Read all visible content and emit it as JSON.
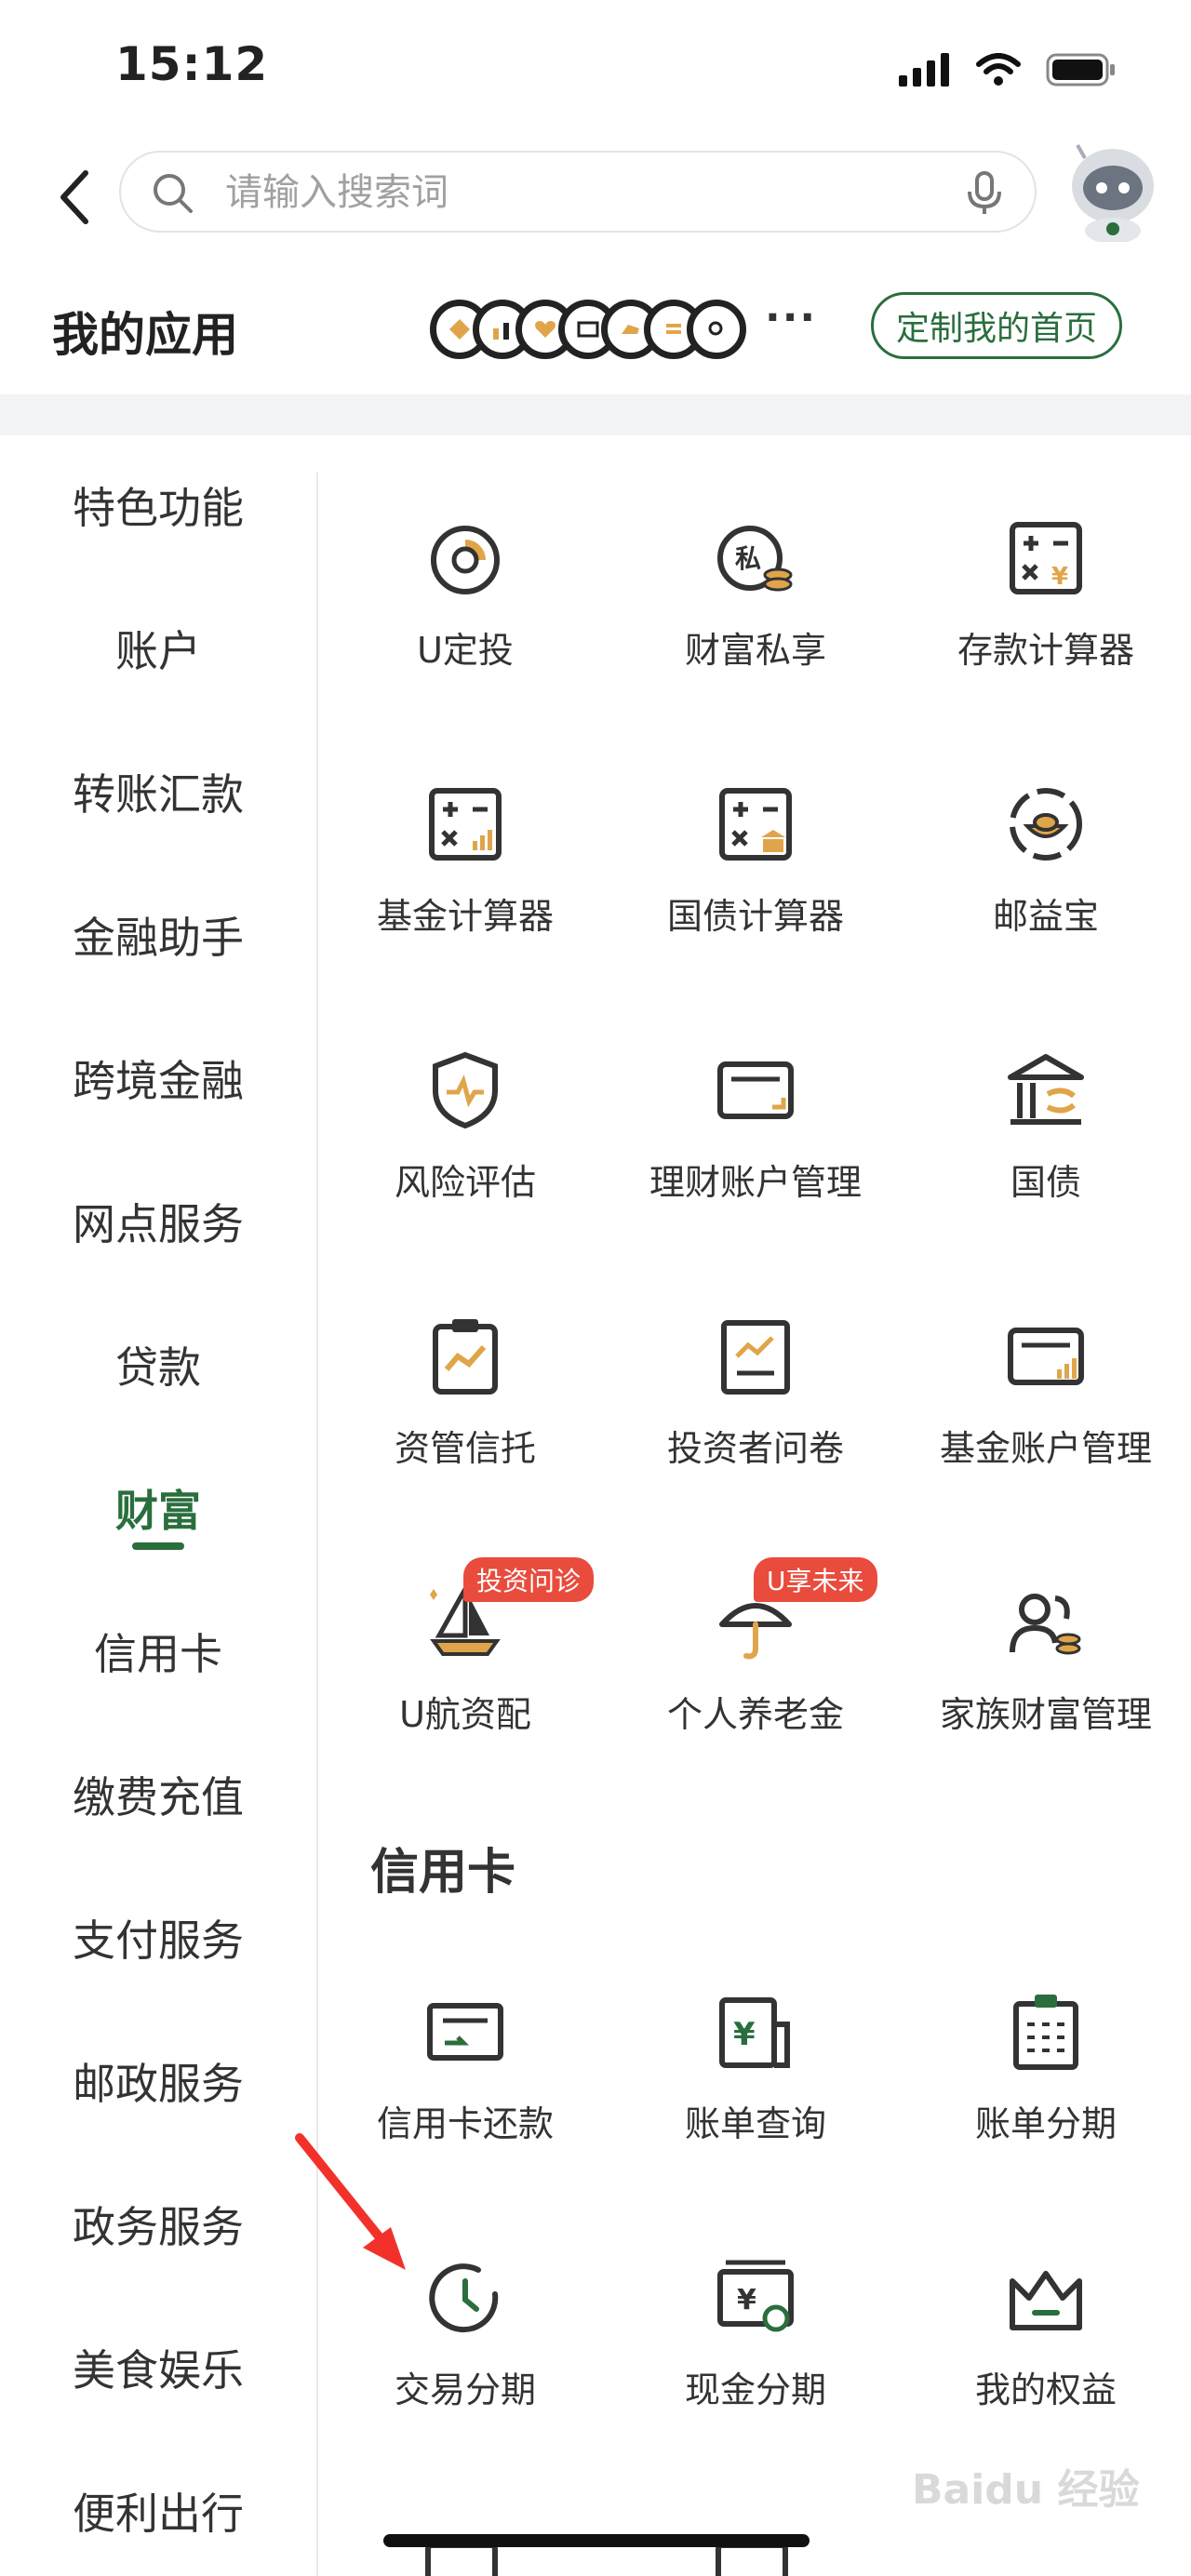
{
  "status_bar": {
    "time": "15:12"
  },
  "search": {
    "placeholder": "请输入搜索词"
  },
  "my_apps": {
    "title": "我的应用",
    "more": "···",
    "customize_label": "定制我的首页"
  },
  "sidebar": {
    "items": [
      {
        "label": "特色功能",
        "active": false
      },
      {
        "label": "账户",
        "active": false
      },
      {
        "label": "转账汇款",
        "active": false
      },
      {
        "label": "金融助手",
        "active": false
      },
      {
        "label": "跨境金融",
        "active": false
      },
      {
        "label": "网点服务",
        "active": false
      },
      {
        "label": "贷款",
        "active": false
      },
      {
        "label": "财富",
        "active": true
      },
      {
        "label": "信用卡",
        "active": false
      },
      {
        "label": "缴费充值",
        "active": false
      },
      {
        "label": "支付服务",
        "active": false
      },
      {
        "label": "邮政服务",
        "active": false
      },
      {
        "label": "政务服务",
        "active": false
      },
      {
        "label": "美食娱乐",
        "active": false
      },
      {
        "label": "便利出行",
        "active": false
      }
    ]
  },
  "wealth_grid": [
    {
      "label": "U定投",
      "icon": "pie-chart-icon"
    },
    {
      "label": "财富私享",
      "icon": "private-wealth-icon"
    },
    {
      "label": "存款计算器",
      "icon": "deposit-calculator-icon"
    },
    {
      "label": "基金计算器",
      "icon": "fund-calculator-icon"
    },
    {
      "label": "国债计算器",
      "icon": "bond-calculator-icon"
    },
    {
      "label": "邮益宝",
      "icon": "ingot-icon"
    },
    {
      "label": "风险评估",
      "icon": "shield-pulse-icon"
    },
    {
      "label": "理财账户管理",
      "icon": "card-icon"
    },
    {
      "label": "国债",
      "icon": "bank-icon"
    },
    {
      "label": "资管信托",
      "icon": "clipboard-chart-icon"
    },
    {
      "label": "投资者问卷",
      "icon": "questionnaire-icon"
    },
    {
      "label": "基金账户管理",
      "icon": "card-chart-icon"
    },
    {
      "label": "U航资配",
      "icon": "sailboat-icon",
      "badge": "投资问诊"
    },
    {
      "label": "个人养老金",
      "icon": "umbrella-icon",
      "badge": "U享未来"
    },
    {
      "label": "家族财富管理",
      "icon": "family-icon"
    }
  ],
  "credit_section": {
    "title": "信用卡"
  },
  "credit_grid": [
    {
      "label": "信用卡还款",
      "icon": "card-repay-icon"
    },
    {
      "label": "账单查询",
      "icon": "bill-query-icon"
    },
    {
      "label": "账单分期",
      "icon": "bill-installment-icon"
    },
    {
      "label": "交易分期",
      "icon": "clock-icon"
    },
    {
      "label": "现金分期",
      "icon": "cash-installment-icon"
    },
    {
      "label": "我的权益",
      "icon": "crown-icon"
    }
  ],
  "watermark": "Baidu 经验",
  "colors": {
    "brand_green": "#2a6e3d",
    "accent_orange": "#e0a54a",
    "badge_red": "#e94b3c",
    "arrow_red": "#f2322a"
  }
}
